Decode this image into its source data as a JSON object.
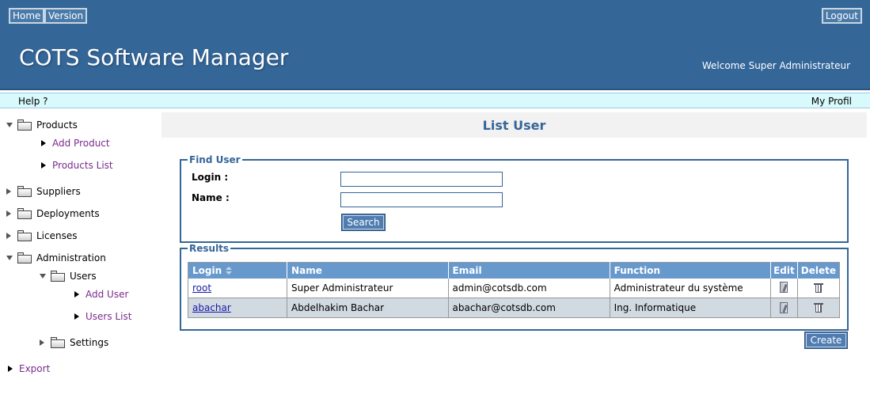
{
  "header": {
    "home_label": "Home",
    "version_label": "Version",
    "logout_label": "Logout",
    "app_title": "COTS Software Manager",
    "welcome_text": "Welcome Super Administrateur"
  },
  "helpbar": {
    "help_label": "Help ?",
    "profile_label": "My Profil"
  },
  "sidebar": {
    "products": "Products",
    "add_product": "Add Product",
    "products_list": "Products List",
    "suppliers": "Suppliers",
    "deployments": "Deployments",
    "licenses": "Licenses",
    "administration": "Administration",
    "users": "Users",
    "add_user": "Add User",
    "users_list": "Users List",
    "settings": "Settings",
    "export": "Export"
  },
  "main": {
    "page_title": "List User",
    "find": {
      "legend": "Find User",
      "login_label": "Login :",
      "login_value": "",
      "name_label": "Name :",
      "name_value": "",
      "search_label": "Search"
    },
    "results": {
      "legend": "Results",
      "columns": [
        "Login",
        "Name",
        "Email",
        "Function",
        "Edit",
        "Delete"
      ],
      "rows": [
        {
          "login": "root",
          "name": "Super Administrateur",
          "email": "admin@cotsdb.com",
          "function": "Administrateur du système"
        },
        {
          "login": "abachar",
          "name": "Abdelhakim Bachar",
          "email": "abachar@cotsdb.com",
          "function": "Ing. Informatique"
        }
      ]
    },
    "create_label": "Create"
  },
  "colors": {
    "header_bg": "#346698",
    "helpbar_bg": "#d8fafc",
    "table_header_bg": "#6799cc",
    "row_alt_bg": "#d1d9e1",
    "accent": "#336699",
    "link_purple": "#7a2a8c"
  },
  "icons": [
    "folder-icon",
    "triangle-expand-icon",
    "triangle-collapse-icon",
    "sort-icon",
    "edit-icon",
    "delete-icon"
  ]
}
